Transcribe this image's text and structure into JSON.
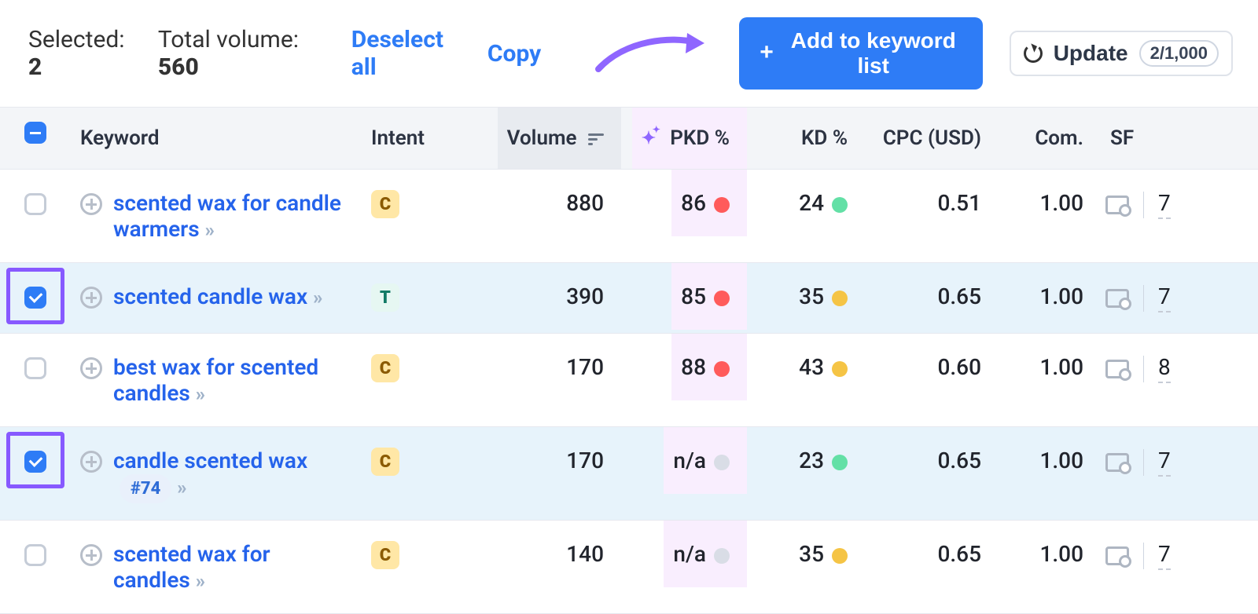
{
  "toolbar": {
    "selected_label": "Selected:",
    "selected_count": "2",
    "volume_label": "Total volume:",
    "volume_value": "560",
    "deselect": "Deselect all",
    "copy": "Copy",
    "add_to_list": "Add to keyword list",
    "update": "Update",
    "update_counter": "2/1,000"
  },
  "headers": {
    "keyword": "Keyword",
    "intent": "Intent",
    "volume": "Volume",
    "pkd": "PKD %",
    "kd": "KD %",
    "cpc": "CPC (USD)",
    "com": "Com.",
    "sf": "SF"
  },
  "rows": [
    {
      "checked": false,
      "keyword": "scented wax for candle warmers",
      "chip": "",
      "intent": "C",
      "volume": "880",
      "pkd": "86",
      "pkd_dot": "dot-red",
      "kd": "24",
      "kd_dot": "dot-green",
      "cpc": "0.51",
      "com": "1.00",
      "sf": "7"
    },
    {
      "checked": true,
      "keyword": "scented candle wax",
      "chip": "",
      "intent": "T",
      "volume": "390",
      "pkd": "85",
      "pkd_dot": "dot-red",
      "kd": "35",
      "kd_dot": "dot-orange",
      "cpc": "0.65",
      "com": "1.00",
      "sf": "7"
    },
    {
      "checked": false,
      "keyword": "best wax for scented candles",
      "chip": "",
      "intent": "C",
      "volume": "170",
      "pkd": "88",
      "pkd_dot": "dot-red",
      "kd": "43",
      "kd_dot": "dot-orange",
      "cpc": "0.60",
      "com": "1.00",
      "sf": "8"
    },
    {
      "checked": true,
      "keyword": "candle scented wax",
      "chip": "#74",
      "intent": "C",
      "volume": "170",
      "pkd": "n/a",
      "pkd_dot": "dot-gray",
      "kd": "23",
      "kd_dot": "dot-green",
      "cpc": "0.65",
      "com": "1.00",
      "sf": "7"
    },
    {
      "checked": false,
      "keyword": "scented wax for candles",
      "chip": "",
      "intent": "C",
      "volume": "140",
      "pkd": "n/a",
      "pkd_dot": "dot-gray",
      "kd": "35",
      "kd_dot": "dot-orange",
      "cpc": "0.65",
      "com": "1.00",
      "sf": "7"
    }
  ]
}
